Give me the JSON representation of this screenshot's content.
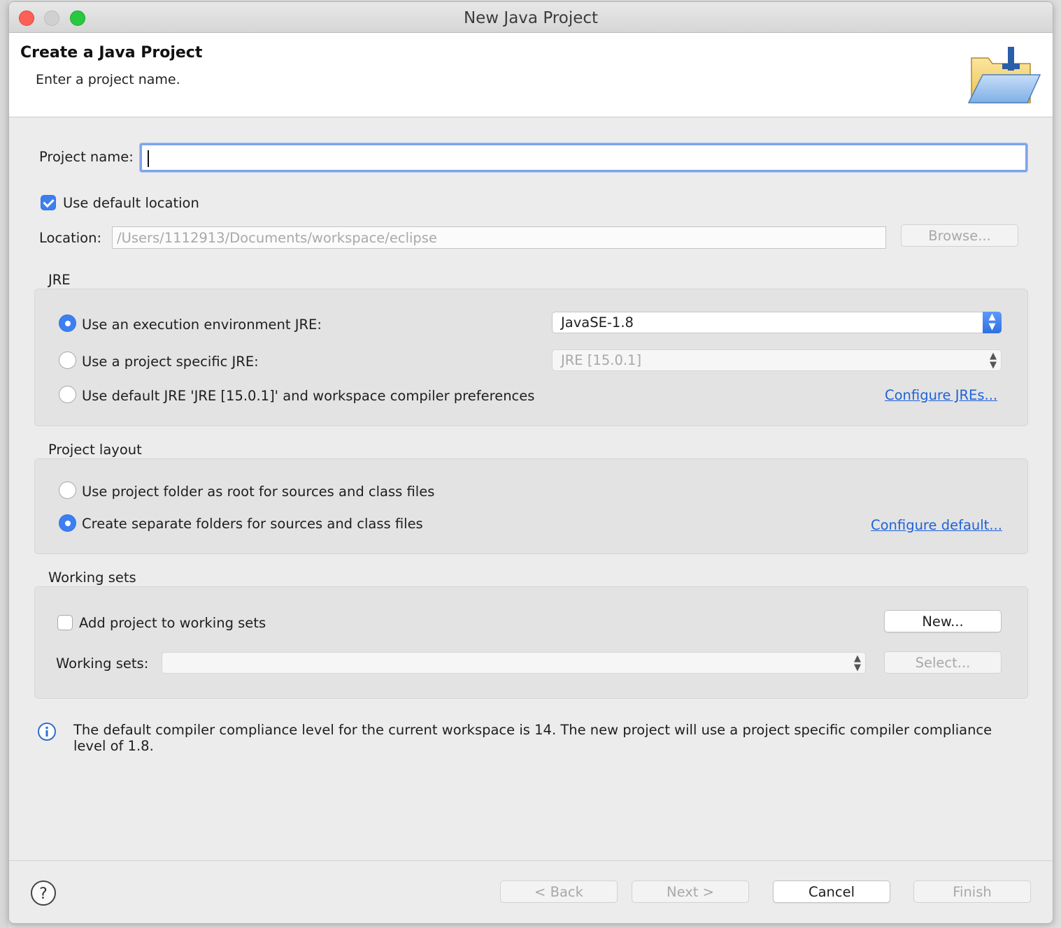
{
  "window": {
    "title": "New Java Project"
  },
  "header": {
    "title": "Create a Java Project",
    "subtitle": "Enter a project name."
  },
  "project_name": {
    "label": "Project name:",
    "value": ""
  },
  "location": {
    "use_default_label": "Use default location",
    "use_default_checked": true,
    "label": "Location:",
    "value": "/Users/1112913/Documents/workspace/eclipse",
    "browse_label": "Browse..."
  },
  "jre": {
    "group_title": "JRE",
    "options": [
      {
        "label": "Use an execution environment JRE:",
        "selected": true
      },
      {
        "label": "Use a project specific JRE:",
        "selected": false
      },
      {
        "label": "Use default JRE 'JRE [15.0.1]' and workspace compiler preferences",
        "selected": false
      }
    ],
    "env_select_value": "JavaSE-1.8",
    "specific_select_value": "JRE [15.0.1]",
    "configure_link": "Configure JREs..."
  },
  "layout": {
    "group_title": "Project layout",
    "options": [
      {
        "label": "Use project folder as root for sources and class files",
        "selected": false
      },
      {
        "label": "Create separate folders for sources and class files",
        "selected": true
      }
    ],
    "configure_link": "Configure default..."
  },
  "working_sets": {
    "group_title": "Working sets",
    "add_label": "Add project to working sets",
    "add_checked": false,
    "new_button": "New...",
    "label": "Working sets:",
    "select_value": "",
    "select_button": "Select..."
  },
  "info": {
    "message": "The default compiler compliance level for the current workspace is 14. The new project will use a project specific compiler compliance level of 1.8."
  },
  "footer": {
    "back": "< Back",
    "next": "Next >",
    "cancel": "Cancel",
    "finish": "Finish"
  },
  "colors": {
    "accent": "#3d7ff0",
    "link": "#1f62d8",
    "focus_ring": "#7ea4e8"
  }
}
